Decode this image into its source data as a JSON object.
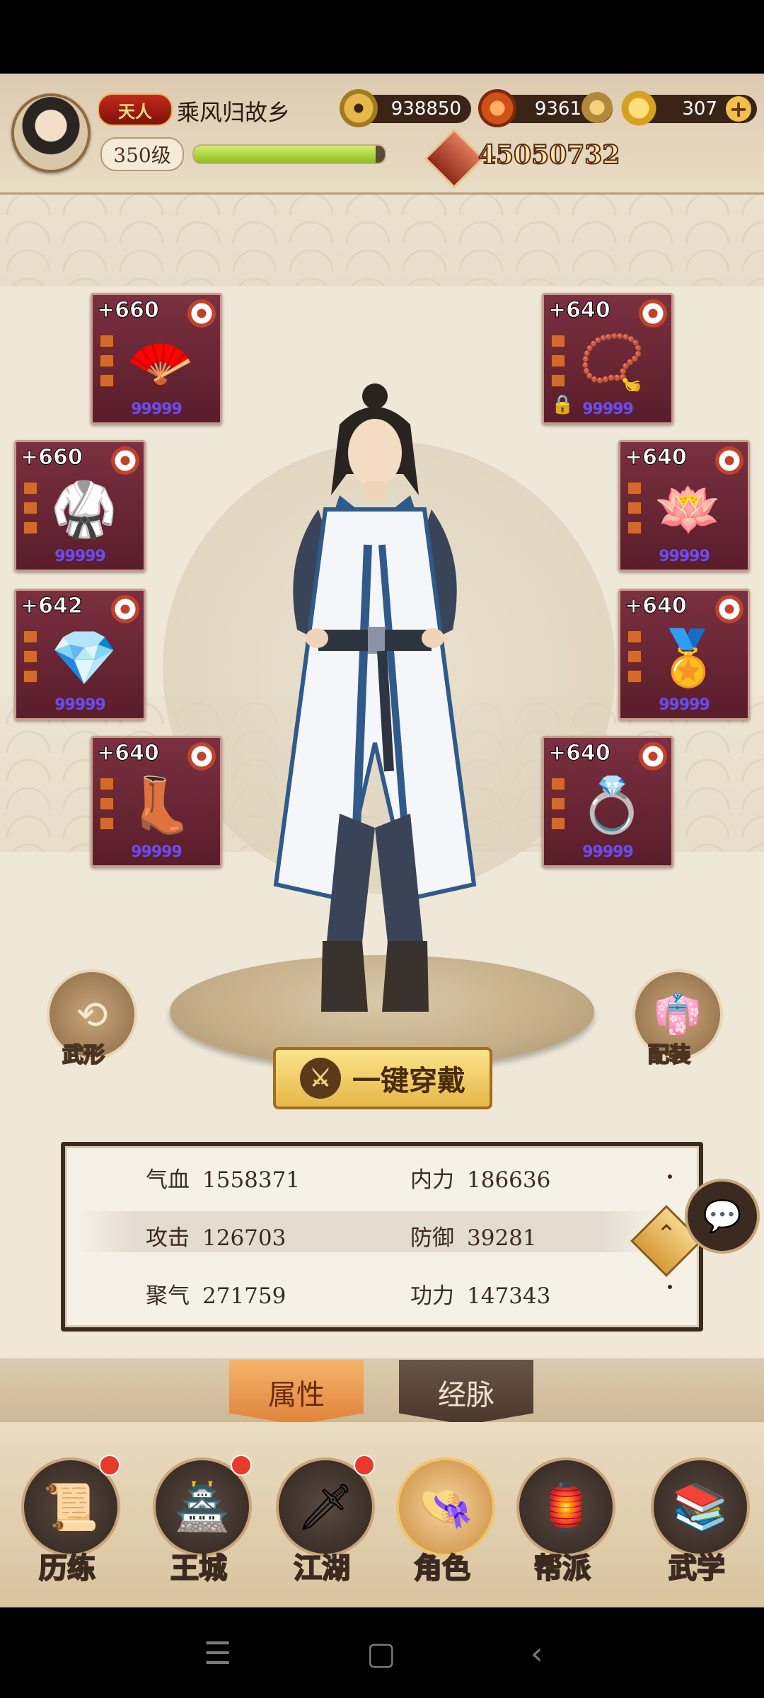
{
  "player": {
    "rank_badge": "天人",
    "name": "乘风归故乡",
    "level": "350级",
    "xp_fraction": 0.95,
    "power": "45050732"
  },
  "resources": {
    "copper": "938850",
    "spirit": "9361",
    "gold": "307"
  },
  "equipment": {
    "fan": {
      "level": "+660",
      "icon": "fan-icon",
      "stars": "99999"
    },
    "necklace": {
      "level": "+640",
      "icon": "necklace-icon",
      "stars": "99999"
    },
    "robe": {
      "level": "+660",
      "icon": "robe-icon",
      "stars": "99999"
    },
    "pendant": {
      "level": "+640",
      "icon": "lotus-pendant-icon",
      "stars": "99999"
    },
    "belt": {
      "level": "+642",
      "icon": "belt-icon",
      "stars": "99999"
    },
    "bracer": {
      "level": "+640",
      "icon": "bracer-icon",
      "stars": "99999"
    },
    "boots": {
      "level": "+640",
      "icon": "boots-icon",
      "stars": "99999"
    },
    "ring": {
      "level": "+640",
      "icon": "ring-icon",
      "stars": "99999"
    }
  },
  "buttons": {
    "form_label": "武形",
    "outfit_label": "配装",
    "equip_all_label": "一键穿戴"
  },
  "stats": {
    "hp": {
      "label": "气血",
      "value": "1558371"
    },
    "internal": {
      "label": "内力",
      "value": "186636"
    },
    "attack": {
      "label": "攻击",
      "value": "126703"
    },
    "defense": {
      "label": "防御",
      "value": "39281"
    },
    "qi": {
      "label": "聚气",
      "value": "271759"
    },
    "skill": {
      "label": "功力",
      "value": "147343"
    }
  },
  "tabs": {
    "attributes": "属性",
    "meridians": "经脉"
  },
  "nav": {
    "training": "历练",
    "city": "王城",
    "jianghu": "江湖",
    "character": "角色",
    "guild": "帮派",
    "martial": "武学"
  },
  "colors": {
    "background": "#efe7d8",
    "slot_bg": "#6a2535",
    "accent_gold": "#e6b84a",
    "active_tab": "#e0823a"
  }
}
